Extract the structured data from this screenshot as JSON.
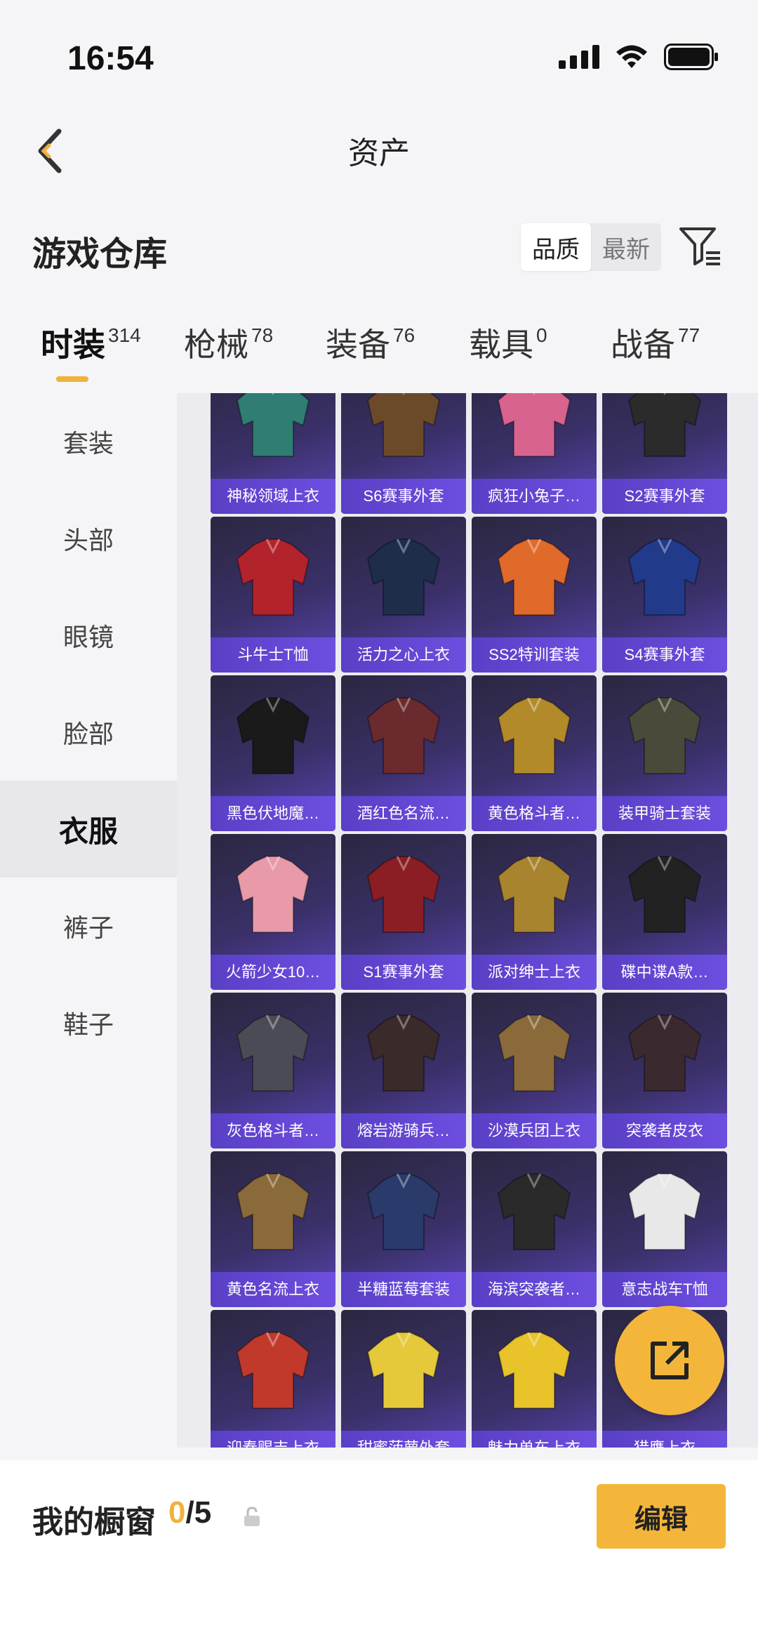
{
  "status_bar": {
    "time": "16:54"
  },
  "nav": {
    "title": "资产"
  },
  "warehouse": {
    "title": "游戏仓库",
    "sort_options": [
      "品质",
      "最新"
    ],
    "sort_active": "品质"
  },
  "tabs": [
    {
      "label": "时装",
      "count": "314",
      "active": true
    },
    {
      "label": "枪械",
      "count": "78"
    },
    {
      "label": "装备",
      "count": "76"
    },
    {
      "label": "载具",
      "count": "0"
    },
    {
      "label": "战备",
      "count": "77"
    }
  ],
  "sidebar": {
    "items": [
      "套装",
      "头部",
      "眼镜",
      "脸部",
      "衣服",
      "裤子",
      "鞋子"
    ],
    "active": "衣服"
  },
  "items": [
    "神秘领域上衣",
    "S6赛事外套",
    "疯狂小兔子…",
    "S2赛事外套",
    "斗牛士T恤",
    "活力之心上衣",
    "SS2特训套装",
    "S4赛事外套",
    "黑色伏地魔…",
    "酒红色名流…",
    "黄色格斗者…",
    "装甲骑士套装",
    "火箭少女10…",
    "S1赛事外套",
    "派对绅士上衣",
    "碟中谍A款…",
    "灰色格斗者…",
    "熔岩游骑兵…",
    "沙漠兵团上衣",
    "突袭者皮衣",
    "黄色名流上衣",
    "半糖蓝莓套装",
    "海滨突袭者…",
    "意志战车T恤",
    "迎春赐吉上衣",
    "甜蜜菠萝外套",
    "魅力单车上衣",
    "猎鹰上衣"
  ],
  "bottom": {
    "showcase_label": "我的橱窗",
    "count_current": "0",
    "count_sep_total": "/5",
    "edit_label": "编辑"
  },
  "colors": {
    "accent": "#f4b63a",
    "card_bg": "#3a3068",
    "card_label_bg": "#5a3fc6"
  }
}
